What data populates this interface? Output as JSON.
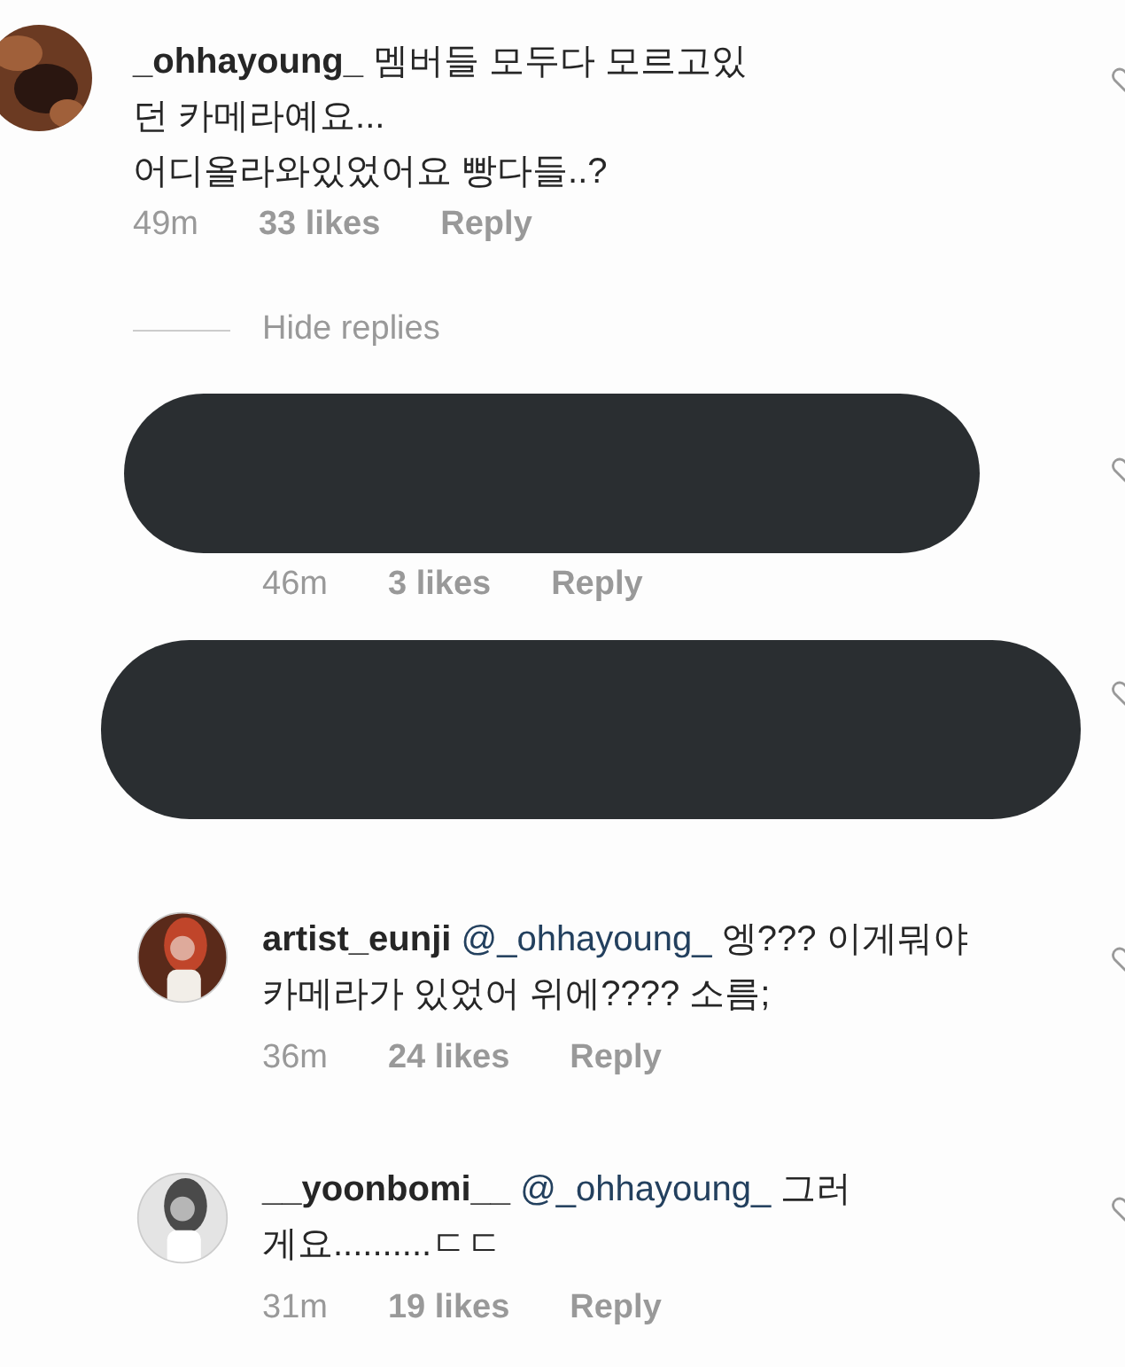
{
  "comments": [
    {
      "username": "_ohhayoung_",
      "text": "멤버들 모두다 모르고있\n던 카메라예요...\n어디올라와있었어요 빵다들..?",
      "time": "49m",
      "likes": "33 likes",
      "reply": "Reply"
    }
  ],
  "hide_replies": "Hide replies",
  "replies": [
    {
      "kind": "redacted",
      "time": "46m",
      "likes": "3 likes",
      "reply": "Reply"
    },
    {
      "kind": "redacted"
    },
    {
      "kind": "comment",
      "username": "artist_eunji",
      "mention": "@_ohhayoung_",
      "text": "엥??? 이게뭐야\n카메라가 있었어 위에???? 소름;",
      "time": "36m",
      "likes": "24 likes",
      "reply": "Reply"
    },
    {
      "kind": "comment",
      "username": "__yoonbomi__",
      "mention": "@_ohhayoung_",
      "text": "그러\n게요..........ㄷㄷ",
      "time": "31m",
      "likes": "19 likes",
      "reply": "Reply"
    }
  ]
}
